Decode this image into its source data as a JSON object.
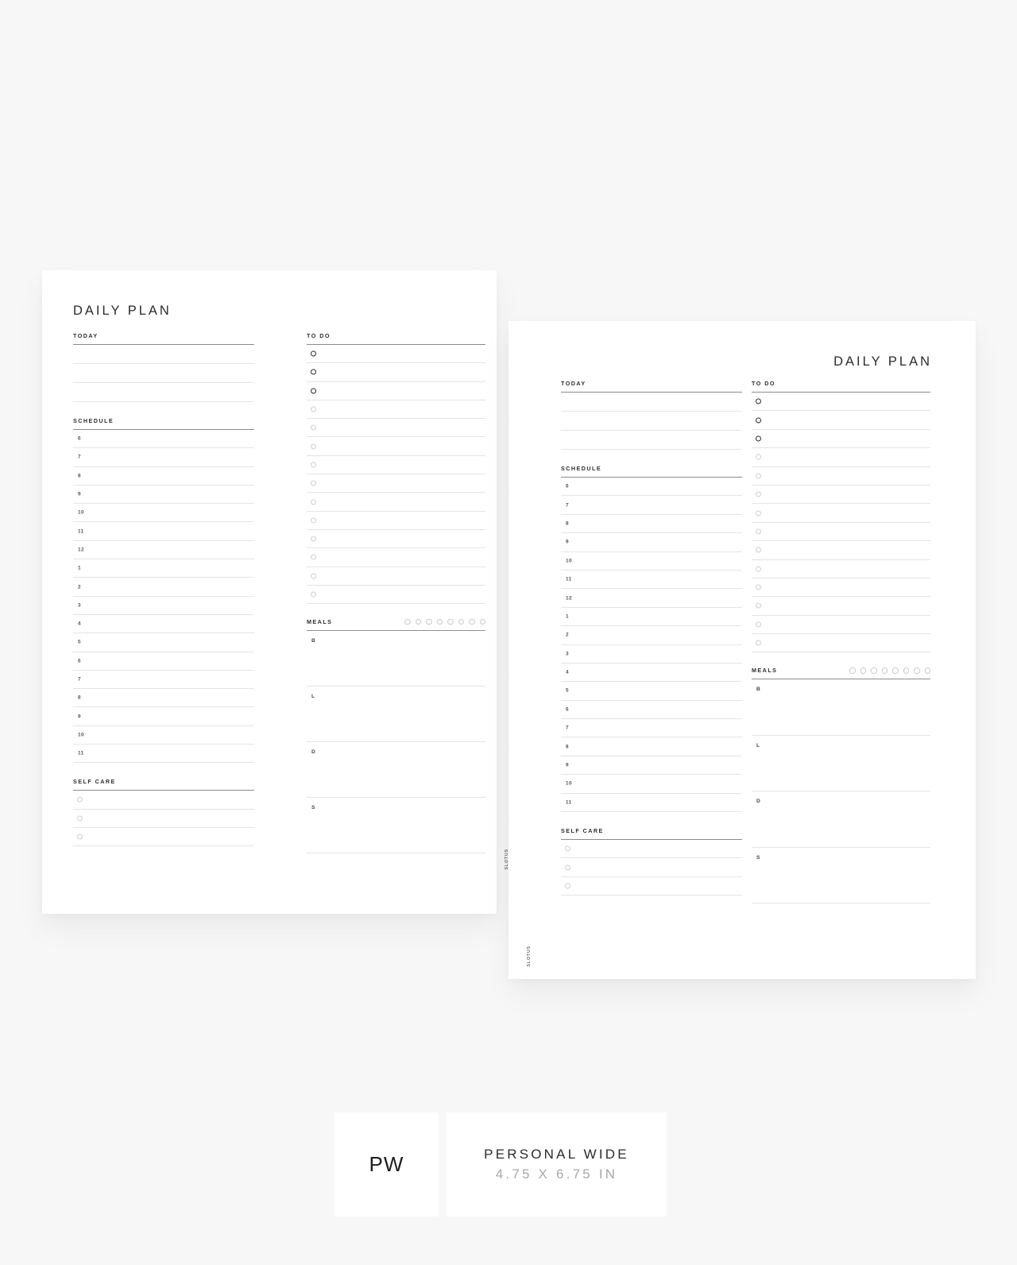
{
  "background_color": "#f7f7f7",
  "page_color": "#ffffff",
  "title": "DAILY PLAN",
  "brandmark": "SLOTUS",
  "sections": {
    "today": {
      "label": "TODAY",
      "rows": 3
    },
    "schedule": {
      "label": "SCHEDULE",
      "hours": [
        "6",
        "7",
        "8",
        "9",
        "10",
        "11",
        "12",
        "1",
        "2",
        "3",
        "4",
        "5",
        "6",
        "7",
        "8",
        "9",
        "10",
        "11"
      ]
    },
    "self_care": {
      "label": "SELF CARE",
      "rows": 3
    },
    "todo": {
      "label": "TO DO",
      "rows": 14,
      "filled_circles": 3
    },
    "meals": {
      "label": "MEALS",
      "tracker_dots": 8,
      "entries": [
        "B",
        "L",
        "D",
        "S"
      ]
    }
  },
  "footer": {
    "abbrev": "PW",
    "size_name": "PERSONAL WIDE",
    "size_dimensions": "4.75 X 6.75 IN"
  },
  "pages": [
    {
      "id": "left",
      "title_align": "left"
    },
    {
      "id": "right",
      "title_align": "right"
    }
  ]
}
